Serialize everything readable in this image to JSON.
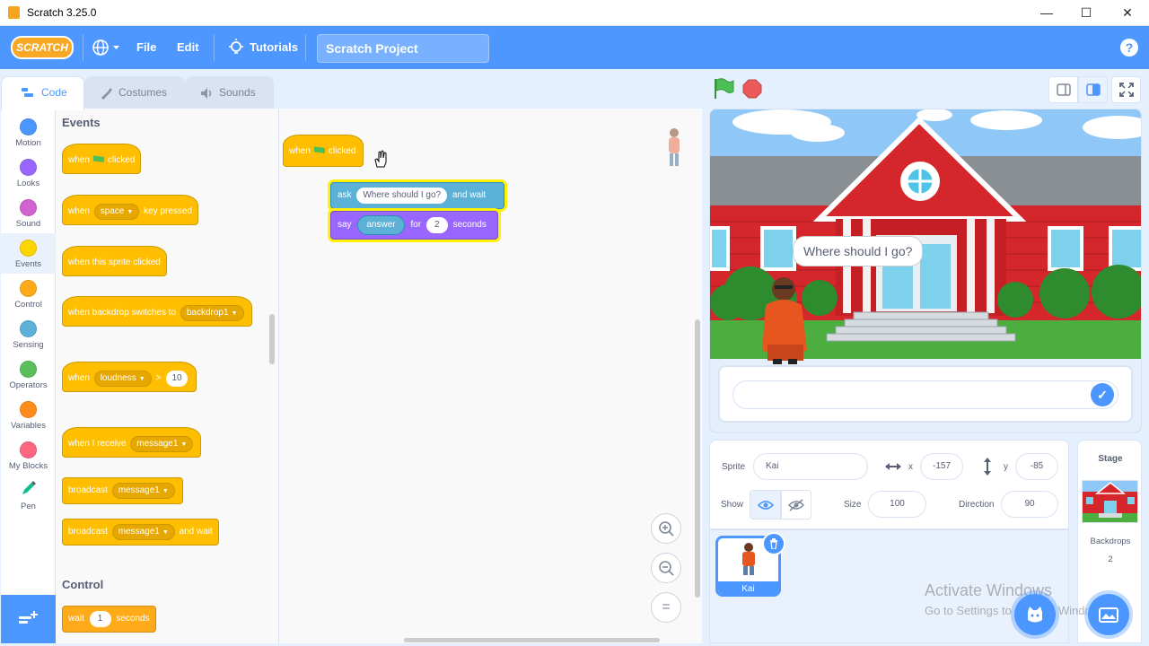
{
  "window": {
    "title": "Scratch 3.25.0",
    "minimize": "—",
    "maximize": "☐",
    "close": "✕"
  },
  "menubar": {
    "logo": "SCRATCH",
    "language_icon": "globe-icon",
    "file": "File",
    "edit": "Edit",
    "tutorials": "Tutorials",
    "project_title": "Scratch Project",
    "help": "?"
  },
  "tabs": {
    "code": "Code",
    "costumes": "Costumes",
    "sounds": "Sounds"
  },
  "categories": [
    {
      "label": "Motion",
      "color": "#4c97ff"
    },
    {
      "label": "Looks",
      "color": "#9966ff"
    },
    {
      "label": "Sound",
      "color": "#cf63cf"
    },
    {
      "label": "Events",
      "color": "#ffd500"
    },
    {
      "label": "Control",
      "color": "#ffab19"
    },
    {
      "label": "Sensing",
      "color": "#5cb1d6"
    },
    {
      "label": "Operators",
      "color": "#59c059"
    },
    {
      "label": "Variables",
      "color": "#ff8c1a"
    },
    {
      "label": "My Blocks",
      "color": "#ff6680"
    },
    {
      "label": "Pen",
      "color": "#0fbd8c"
    }
  ],
  "palette": {
    "events_title": "Events",
    "control_title": "Control",
    "when": "when",
    "clicked": "clicked",
    "space": "space",
    "key_pressed": "key pressed",
    "when_this_sprite_clicked": "when this sprite clicked",
    "when_backdrop_switches_to": "when backdrop switches to",
    "backdrop1": "backdrop1",
    "loudness": "loudness",
    "gt": ">",
    "loudness_value": "10",
    "when_i_receive": "when I receive",
    "message1": "message1",
    "broadcast": "broadcast",
    "and_wait": "and wait",
    "wait": "wait",
    "wait_value": "1",
    "seconds": "seconds"
  },
  "script": {
    "when": "when",
    "clicked": "clicked",
    "ask": "ask",
    "ask_text": "Where should I go?",
    "and_wait": "and wait",
    "say": "say",
    "answer": "answer",
    "for": "for",
    "say_seconds_value": "2",
    "seconds": "seconds"
  },
  "zoom": {
    "zoom_in": "+",
    "zoom_out": "−",
    "reset": "="
  },
  "stage": {
    "speech_bubble": "Where should I go?",
    "check": "✓"
  },
  "sprite_info": {
    "sprite_label": "Sprite",
    "sprite_name": "Kai",
    "x_label": "x",
    "x_value": "-157",
    "y_label": "y",
    "y_value": "-85",
    "show_label": "Show",
    "size_label": "Size",
    "size_value": "100",
    "direction_label": "Direction",
    "direction_value": "90"
  },
  "sprite_list": {
    "sprite_name": "Kai"
  },
  "stage_pane": {
    "title": "Stage",
    "backdrops_label": "Backdrops",
    "backdrops_count": "2"
  },
  "watermark": {
    "line1": "Activate Windows",
    "line2": "Go to Settings to activate Windows."
  },
  "colors": {
    "scratch_blue": "#4d97ff",
    "events_yellow": "#ffbf00",
    "sensing_blue": "#5cb1d6",
    "looks_purple": "#9966ff"
  }
}
